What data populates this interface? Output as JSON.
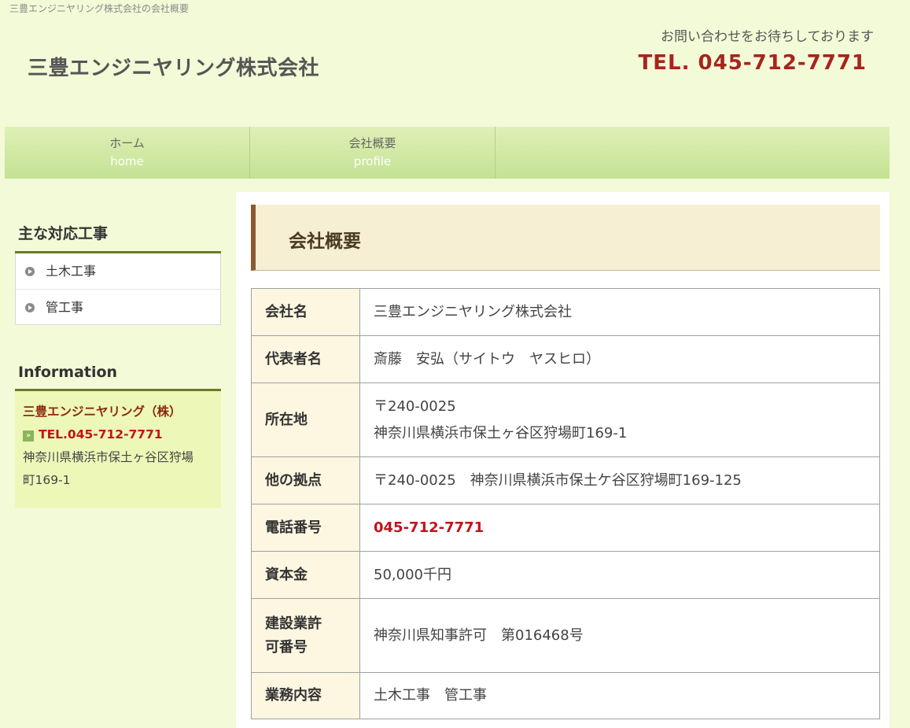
{
  "breadcrumb": "三豊エンジニヤリング株式会社の会社概要",
  "header": {
    "title": "三豊エンジニヤリング株式会社",
    "contact_text": "お問い合わせをお待ちしております",
    "tel": "TEL. 045-712-7771"
  },
  "nav": [
    {
      "jp": "ホーム",
      "en": "home"
    },
    {
      "jp": "会社概要",
      "en": "profile"
    }
  ],
  "sidebar": {
    "works_heading": "主な対応工事",
    "works": [
      "土木工事",
      "管工事"
    ],
    "info_heading": "Information",
    "info_name": "三豊エンジニヤリング（株）",
    "info_tel": "TEL.045-712-7771",
    "info_address_1": "神奈川県横浜市保土ヶ谷区狩場",
    "info_address_2": "町169-1"
  },
  "main": {
    "heading": "会社概要",
    "rows": [
      {
        "key": "会社名",
        "value": "三豊エンジニヤリング株式会社"
      },
      {
        "key": "代表者名",
        "value": "斎藤　安弘（サイトウ　ヤスヒロ）"
      },
      {
        "key": "所在地",
        "value": "〒240-0025",
        "value2": "神奈川県横浜市保土ヶ谷区狩場町169-1"
      },
      {
        "key": "他の拠点",
        "value": "〒240-0025　神奈川県横浜市保土ケ谷区狩場町169-125"
      },
      {
        "key": "電話番号",
        "value": "045-712-7771"
      },
      {
        "key": "資本金",
        "value": "50,000千円"
      },
      {
        "key": "建設業許",
        "key2": "可番号",
        "value": "神奈川県知事許可　第016468号"
      },
      {
        "key": "業務内容",
        "value": "土木工事　管工事"
      }
    ]
  }
}
